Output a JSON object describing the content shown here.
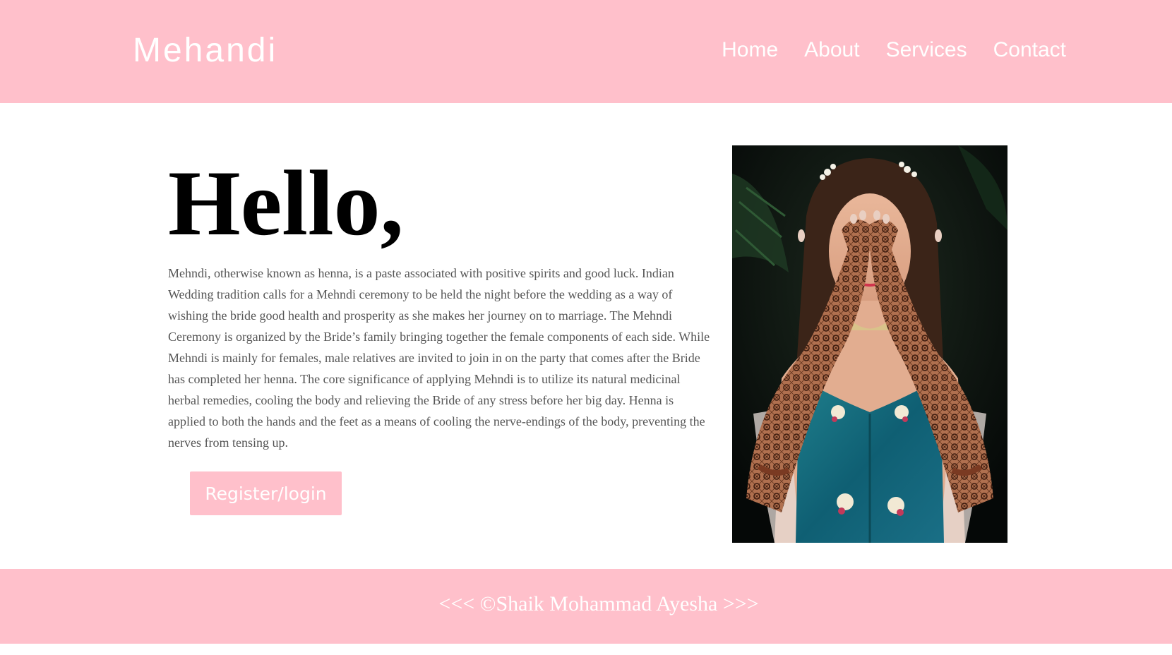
{
  "header": {
    "brand": "Mehandi",
    "nav": [
      "Home",
      "About",
      "Services",
      "Contact"
    ]
  },
  "hero": {
    "heading": "Hello,",
    "description": "Mehndi, otherwise known as henna, is a paste associated with positive spirits and good luck. Indian Wedding tradition calls for a Mehndi ceremony to be held the night before the wedding as a way of wishing the bride good health and prosperity as she makes her journey on to marriage. The Mehndi Ceremony is organized by the Bride’s family bringing together the female components of each side. While Mehndi is mainly for females, male relatives are invited to join in on the party that comes after the Bride has completed her henna. The core significance of applying Mehndi is to utilize its natural medicinal herbal remedies, cooling the body and relieving the Bride of any stress before her big day. Henna is applied to both the hands and the feet as a means of cooling the nerve-endings of the body, preventing the nerves from tensing up.",
    "button": "Register/login"
  },
  "footer": {
    "copyright": "<<< ©Shaik Mohammad Ayesha >>>"
  },
  "colors": {
    "accent": "#ffc0cb",
    "text": "#555555",
    "heading": "#000000"
  }
}
